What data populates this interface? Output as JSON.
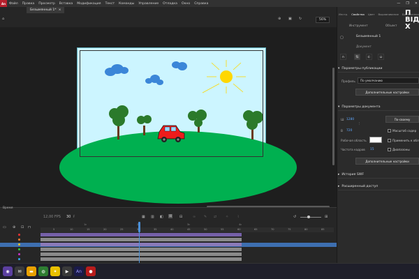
{
  "menubar": {
    "logo": "An",
    "items": [
      "Файл",
      "Правка",
      "Просмотр",
      "Вставка",
      "Модификация",
      "Текст",
      "Команды",
      "Управление",
      "Отладка",
      "Окно",
      "Справка"
    ],
    "window_controls": [
      "—",
      "❐",
      "✕"
    ]
  },
  "document_tab": {
    "label": "Безымянный 1*",
    "close": "×"
  },
  "zoom": "56%",
  "timeline": {
    "title": "Время",
    "fps": "12,00 FPS",
    "frame": "30",
    "frame_unit": "F",
    "ruler_ticks": [
      "5",
      "10",
      "15",
      "20",
      "25",
      "30",
      "35",
      "40",
      "45",
      "50",
      "55",
      "60",
      "65",
      "70",
      "75",
      "80",
      "85"
    ],
    "ruler_top_marks": [
      "1c",
      "2c",
      "3c",
      "4c"
    ]
  },
  "properties": {
    "panel_tabs": [
      "Инстр.",
      "Свойства",
      "Цвет",
      "Выравнивание",
      "Библиотека",
      "Ко..."
    ],
    "sub_tabs": [
      "Инструмент",
      "Объект"
    ],
    "doc_name": "Безымянный 1",
    "doc_kind": "Документ",
    "publish_section": "Параметры публикации",
    "profile_label": "Профиль",
    "profile_value": "По умолчанию",
    "adv_settings_1": "Дополнительные настройки",
    "doc_section": "Параметры документа",
    "width": "1280",
    "height": "720",
    "width_label": "Ш",
    "height_label": "В",
    "default_btn": "По-своему",
    "scale_label": "Масштаб содер",
    "stage_label": "Рабочая область",
    "apply_label": "Применить к обл",
    "fps_label": "Частота кадров",
    "fps_value": "15",
    "ranges_label": "Диапазоны",
    "adv_settings_2": "Дополнительные настройки",
    "swf_history": "История SWF",
    "extended_access": "Расширенный доступ"
  },
  "overlay": {
    "line1": "П",
    "line2": "ВІД",
    "line3": "Х"
  },
  "colors": {
    "accent": "#4a90d9",
    "layer_purple": "#8a7ab8",
    "stage": "#ccf5ff",
    "ground": "#00b050",
    "brand": "#b8202d"
  }
}
